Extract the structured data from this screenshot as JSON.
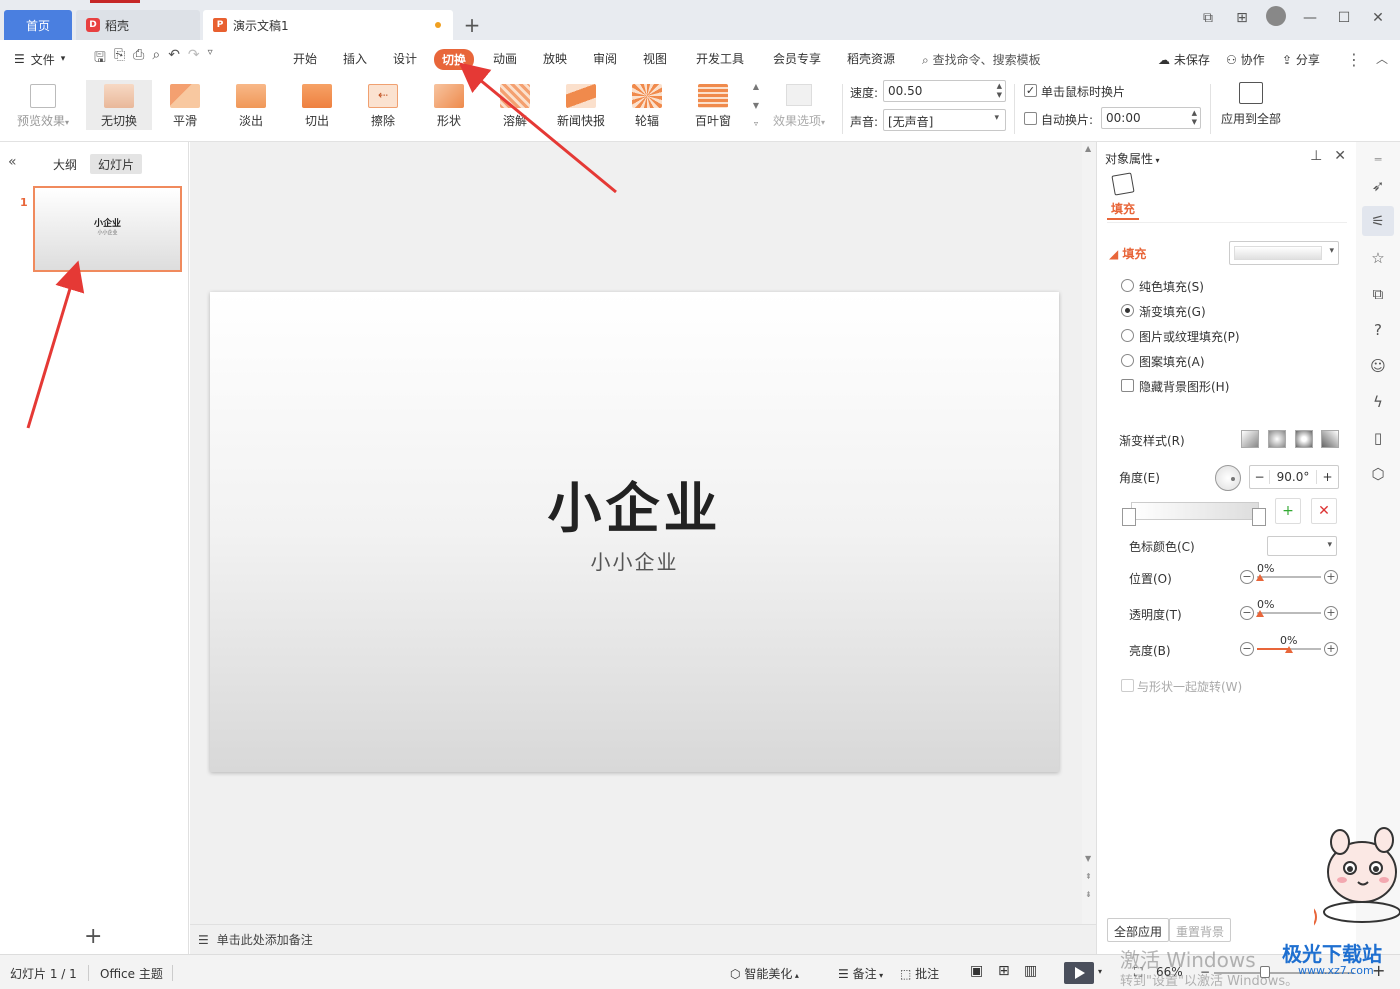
{
  "tabs": {
    "home": "首页",
    "daoke": "稻壳",
    "doc": "演示文稿1"
  },
  "window": {
    "icons": [
      "dual-window-icon",
      "grid-apps-icon",
      "avatar",
      "minimize-icon",
      "maximize-icon",
      "close-icon"
    ]
  },
  "menu": {
    "file": "文件",
    "items": [
      "开始",
      "插入",
      "设计",
      "切换",
      "动画",
      "放映",
      "审阅",
      "视图",
      "开发工具",
      "会员专享",
      "稻壳资源"
    ],
    "active": "切换",
    "search": "查找命令、搜索模板",
    "unsaved": "未保存",
    "collab": "协作",
    "share": "分享"
  },
  "ribbon": {
    "preview": "预览效果",
    "transitions": [
      "无切换",
      "平滑",
      "淡出",
      "切出",
      "擦除",
      "形状",
      "溶解",
      "新闻快报",
      "轮辐",
      "百叶窗"
    ],
    "selected_transition": "无切换",
    "effect_options": "效果选项",
    "speed_label": "速度:",
    "speed_value": "00.50",
    "sound_label": "声音:",
    "sound_value": "[无声音]",
    "on_click": "单击鼠标时换片",
    "on_click_checked": true,
    "auto": "自动换片:",
    "auto_checked": false,
    "auto_value": "00:00",
    "apply_all": "应用到全部"
  },
  "left_panel": {
    "tab_outline": "大纲",
    "tab_slides": "幻灯片",
    "slide_number": "1",
    "thumb_title": "小企业",
    "thumb_sub": "小小企业"
  },
  "slide": {
    "title": "小企业",
    "subtitle": "小小企业"
  },
  "notes_placeholder": "单击此处添加备注",
  "properties": {
    "header": "对象属性",
    "tab_fill": "填充",
    "section_fill": "填充",
    "options": [
      "纯色填充(S)",
      "渐变填充(G)",
      "图片或纹理填充(P)",
      "图案填充(A)"
    ],
    "selected_option": "渐变填充(G)",
    "hide_bg": "隐藏背景图形(H)",
    "gradient_style": "渐变样式(R)",
    "angle_label": "角度(E)",
    "angle_value": "90.0°",
    "stop_color": "色标颜色(C)",
    "position": "位置(O)",
    "position_value": "0%",
    "transparency": "透明度(T)",
    "transparency_value": "0%",
    "brightness": "亮度(B)",
    "brightness_value": "0%",
    "rotate_with_shape": "与形状一起旋转(W)",
    "apply_all": "全部应用",
    "reset_bg": "重置背景"
  },
  "statusbar": {
    "slide_info": "幻灯片 1 / 1",
    "theme": "Office 主题",
    "smart": "智能美化",
    "notes": "备注",
    "comments": "批注",
    "zoom": "66%"
  },
  "overlay": {
    "activate_line1": "激活 Windows",
    "activate_line2": "转到\"设置\"以激活 Windows。",
    "brand": "极光下载站",
    "brand_url": "www.xz7.com"
  },
  "colors": {
    "accent": "#e8663a",
    "home_tab": "#4a7fe0",
    "annotation_arrow": "#e53935"
  }
}
